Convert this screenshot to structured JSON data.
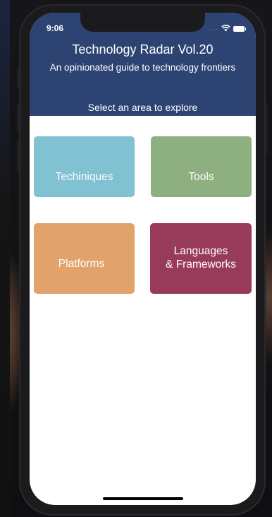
{
  "status_bar": {
    "time": "9:06",
    "wifi_icon": "wifi-icon",
    "battery_icon": "battery-icon"
  },
  "header": {
    "title": "Technology Radar Vol.20",
    "subtitle": "An opinionated guide to technology frontiers",
    "prompt": "Select an area to explore"
  },
  "tiles": [
    {
      "label": "Techiniques",
      "color": "#80c1d2"
    },
    {
      "label": "Tools",
      "color": "#8eb081"
    },
    {
      "label": "Platforms",
      "color": "#e1a36b"
    },
    {
      "label": "Languages\n& Frameworks",
      "color": "#983a59"
    }
  ],
  "colors": {
    "header_bg": "#2d4472",
    "screen_bg": "#ffffff"
  }
}
